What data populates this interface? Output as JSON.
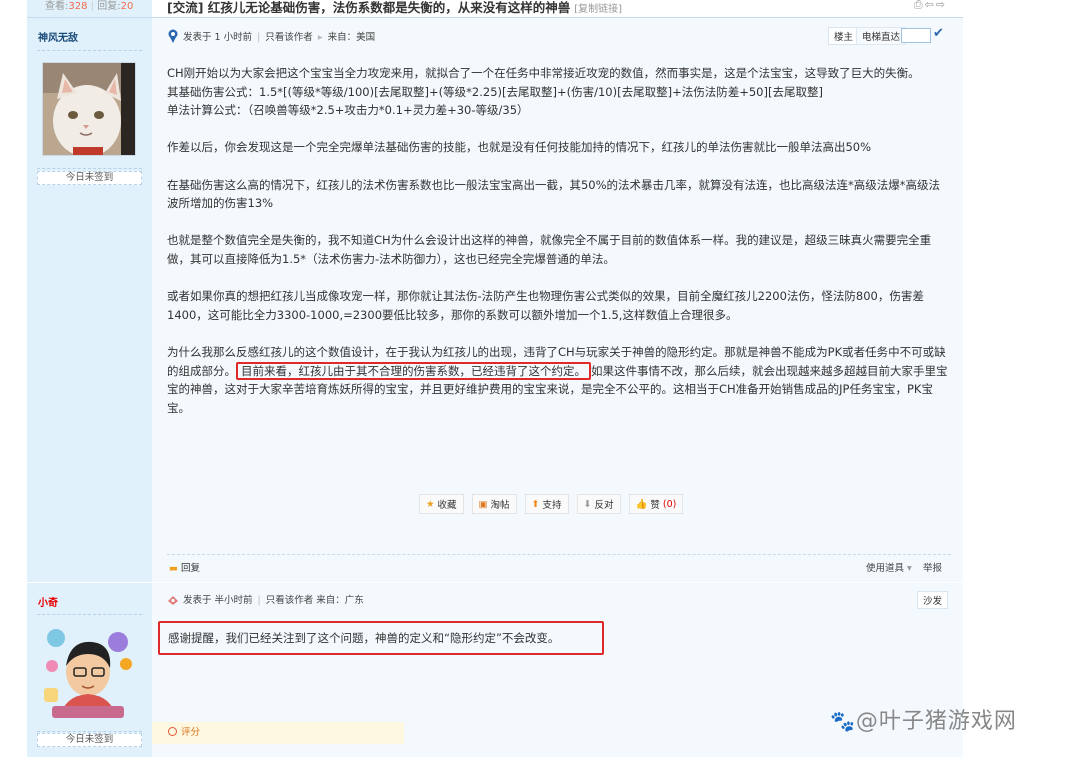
{
  "header": {
    "views_label": "查看:",
    "views_count": "328",
    "replies_label": "回复:",
    "replies_count": "20",
    "thread_title": "[交流] 红孩儿无论基础伤害，法伤系数都是失衡的，从来没有这样的神兽",
    "copy_link": "[复制链接]"
  },
  "post1": {
    "author": "神风无敌",
    "signin": "今日未签到",
    "posted": "发表于 1 小时前",
    "only_author": "只看该作者",
    "from": "来自：美国",
    "floor": "楼主",
    "elevator": "电梯直达",
    "paragraphs": [
      [
        "CH刚开始以为大家会把这个宝宝当全力攻宠来用，就拟合了一个在任务中非常接近攻宠的数值，然而事实是，这是个法宝宝，这导致了巨大的失衡。",
        "其基础伤害公式：1.5*[(等级*等级/100)[去尾取整]+(等级*2.25)[去尾取整]+(伤害/10)[去尾取整]+法伤法防差+50][去尾取整]",
        "单法计算公式：（召唤兽等级*2.5+攻击力*0.1+灵力差+30-等级/35）"
      ],
      [
        "作差以后，你会发现这是一个完全完爆单法基础伤害的技能，也就是没有任何技能加持的情况下，红孩儿的单法伤害就比一般单法高出50%"
      ],
      [
        "在基础伤害这么高的情况下，红孩儿的法术伤害系数也比一般法宝宝高出一截，其50%的法术暴击几率，就算没有法连，也比高级法连*高级法爆*高级法波所增加的伤害13%"
      ],
      [
        "也就是整个数值完全是失衡的，我不知道CH为什么会设计出这样的神兽，就像完全不属于目前的数值体系一样。我的建议是，超级三昧真火需要完全重做，其可以直接降低为1.5*（法术伤害力-法术防御力），这也已经完全完爆普通的单法。"
      ],
      [
        "或者如果你真的想把红孩儿当成像攻宠一样，那你就让其法伤-法防产生也物理伤害公式类似的效果，目前全魔红孩儿2200法伤，怪法防800，伤害差1400，这可能比全力3300-1000,=2300要低比较多，那你的系数可以额外增加一个1.5,这样数值上合理很多。"
      ]
    ],
    "last_para_before": "为什么我那么反感红孩儿的这个数值设计，在于我认为红孩儿的出现，违背了CH与玩家关于神兽的隐形约定。那就是神兽不能成为PK或者任务中不可或缺的组成部分。",
    "last_para_highlight": "目前来看，红孩儿由于其不合理的伤害系数，已经违背了这个约定。",
    "last_para_after": "如果这件事情不改，那么后续，就会出现越来越多超越目前大家手里宝宝的神兽，这对于大家辛苦培育炼妖所得的宝宝，并且更好维护费用的宝宝来说，是完全不公平的。这相当于CH准备开始销售成品的JP任务宝宝，PK宝宝。",
    "actions": {
      "favorite": "收藏",
      "share": "淘帖",
      "support": "支持",
      "oppose": "反对",
      "like": "赞",
      "like_count": "(0)"
    },
    "reply": "回复",
    "use_tools": "使用道具",
    "report": "举报"
  },
  "post2": {
    "author": "小奇",
    "signin": "今日未签到",
    "posted": "发表于 半小时前",
    "only_author": "只看该作者",
    "from": "来自：广东",
    "floor": "沙发",
    "content": "感谢提醒，我们已经关注到了这个问题，神兽的定义和“隐形约定”不会改变。",
    "rate": "评分"
  },
  "watermark": "@叶子猪游戏网",
  "colors": {
    "sidebar_bg": "#e1f1fb",
    "content_bg": "#f3f9fd",
    "highlight_border": "#e02a2a",
    "author2": "#e60000"
  }
}
